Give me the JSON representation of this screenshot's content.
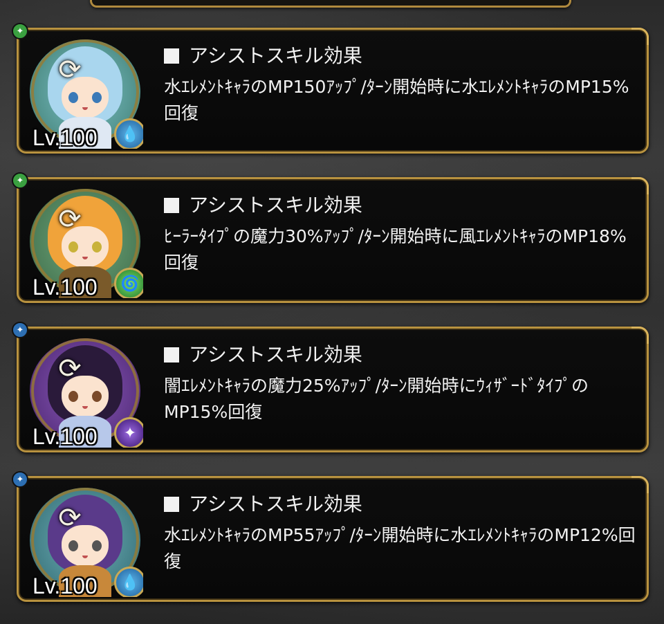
{
  "cards": [
    {
      "level": "Lv.100",
      "section_title": "アシストスキル効果",
      "description": "水ｴﾚﾒﾝﾄｷｬﾗのMP150ｱｯﾌﾟ/ﾀｰﾝ開始時に水ｴﾚﾒﾝﾄｷｬﾗのMP15%回復",
      "attribute_icon": "green-emblem-icon",
      "element_icon": "water-drop-icon",
      "element_color": "#2f8fd0"
    },
    {
      "level": "Lv.100",
      "section_title": "アシストスキル効果",
      "description": "ﾋｰﾗｰﾀｲﾌﾟの魔力30%ｱｯﾌﾟ/ﾀｰﾝ開始時に風ｴﾚﾒﾝﾄｷｬﾗのMP18%回復",
      "attribute_icon": "green-emblem-icon",
      "element_icon": "wind-swirl-icon",
      "element_color": "#3aa83a"
    },
    {
      "level": "Lv.100",
      "section_title": "アシストスキル効果",
      "description": "闇ｴﾚﾒﾝﾄｷｬﾗの魔力25%ｱｯﾌﾟ/ﾀｰﾝ開始時にｳｨｻﾞｰﾄﾞﾀｲﾌﾟのMP15%回復",
      "attribute_icon": "blue-emblem-icon",
      "element_icon": "dark-star-icon",
      "element_color": "#6a2ab8"
    },
    {
      "level": "Lv.100",
      "section_title": "アシストスキル効果",
      "description": "水ｴﾚﾒﾝﾄｷｬﾗのMP55ｱｯﾌﾟ/ﾀｰﾝ開始時に水ｴﾚﾒﾝﾄｷｬﾗのMP12%回復",
      "attribute_icon": "blue-emblem-icon",
      "element_icon": "water-drop-icon",
      "element_color": "#2f8fd0"
    }
  ],
  "colors": {
    "frame_gold": "#b8923f",
    "card_bg": "#0a0a0a",
    "text": "#f2f2f2"
  }
}
